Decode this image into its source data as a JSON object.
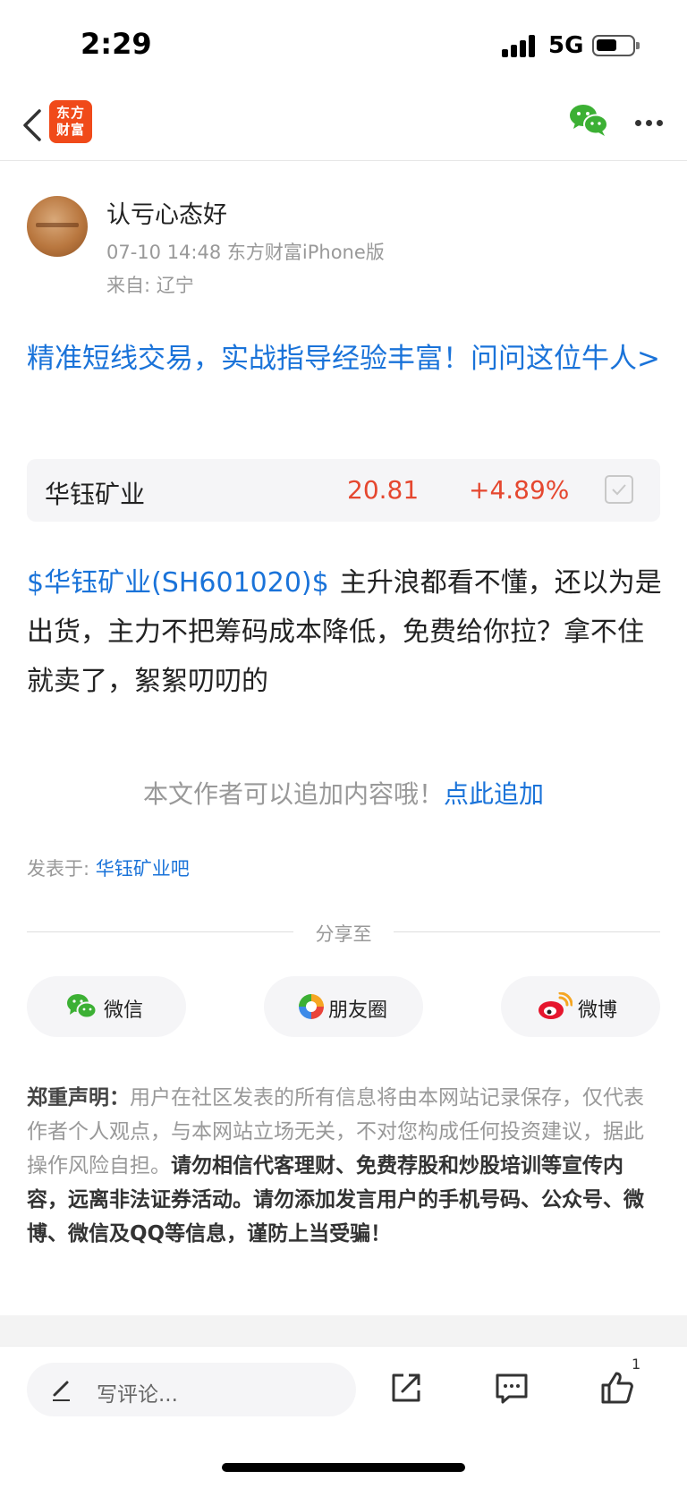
{
  "status_bar": {
    "time": "2:29",
    "network": "5G"
  },
  "nav": {
    "logo_line1": "东方",
    "logo_line2": "财富"
  },
  "author": {
    "name": "认亏心态好",
    "meta": "07-10 14:48 东方财富iPhone版",
    "location": "来自: 辽宁"
  },
  "promo": {
    "text": "精准短线交易，实战指导经验丰富！问问这位牛人>"
  },
  "stock": {
    "name": "华钰矿业",
    "price": "20.81",
    "change": "+4.89%"
  },
  "post": {
    "stock_tag": "$华钰矿业(SH601020)$",
    "text": "主升浪都看不懂，还以为是出货，主力不把筹码成本降低，免费给你拉？拿不住就卖了，絮絮叨叨的"
  },
  "append": {
    "hint": "本文作者可以追加内容哦！",
    "link": "点此追加"
  },
  "posted_in": {
    "label": "发表于: ",
    "forum": "华钰矿业吧"
  },
  "share": {
    "title": "分享至",
    "buttons": [
      {
        "label": "微信",
        "icon": "wechat-icon"
      },
      {
        "label": "朋友圈",
        "icon": "moments-icon"
      },
      {
        "label": "微博",
        "icon": "weibo-icon"
      }
    ]
  },
  "disclaimer": {
    "lead": "郑重声明：",
    "normal": "用户在社区发表的所有信息将由本网站记录保存，仅代表作者个人观点，与本网站立场无关，不对您构成任何投资建议，据此操作风险自担。",
    "emphasis": "请勿相信代客理财、免费荐股和炒股培训等宣传内容，远离非法证券活动。请勿添加发言用户的手机号码、公众号、微博、微信及QQ等信息，谨防上当受骗！"
  },
  "bottom_bar": {
    "comment_placeholder": "写评论...",
    "like_count": "1"
  },
  "colors": {
    "link_blue": "#1a73d9",
    "price_red": "#e5472f",
    "brand_orange": "#f04a1a",
    "wechat_green": "#3cb034"
  }
}
